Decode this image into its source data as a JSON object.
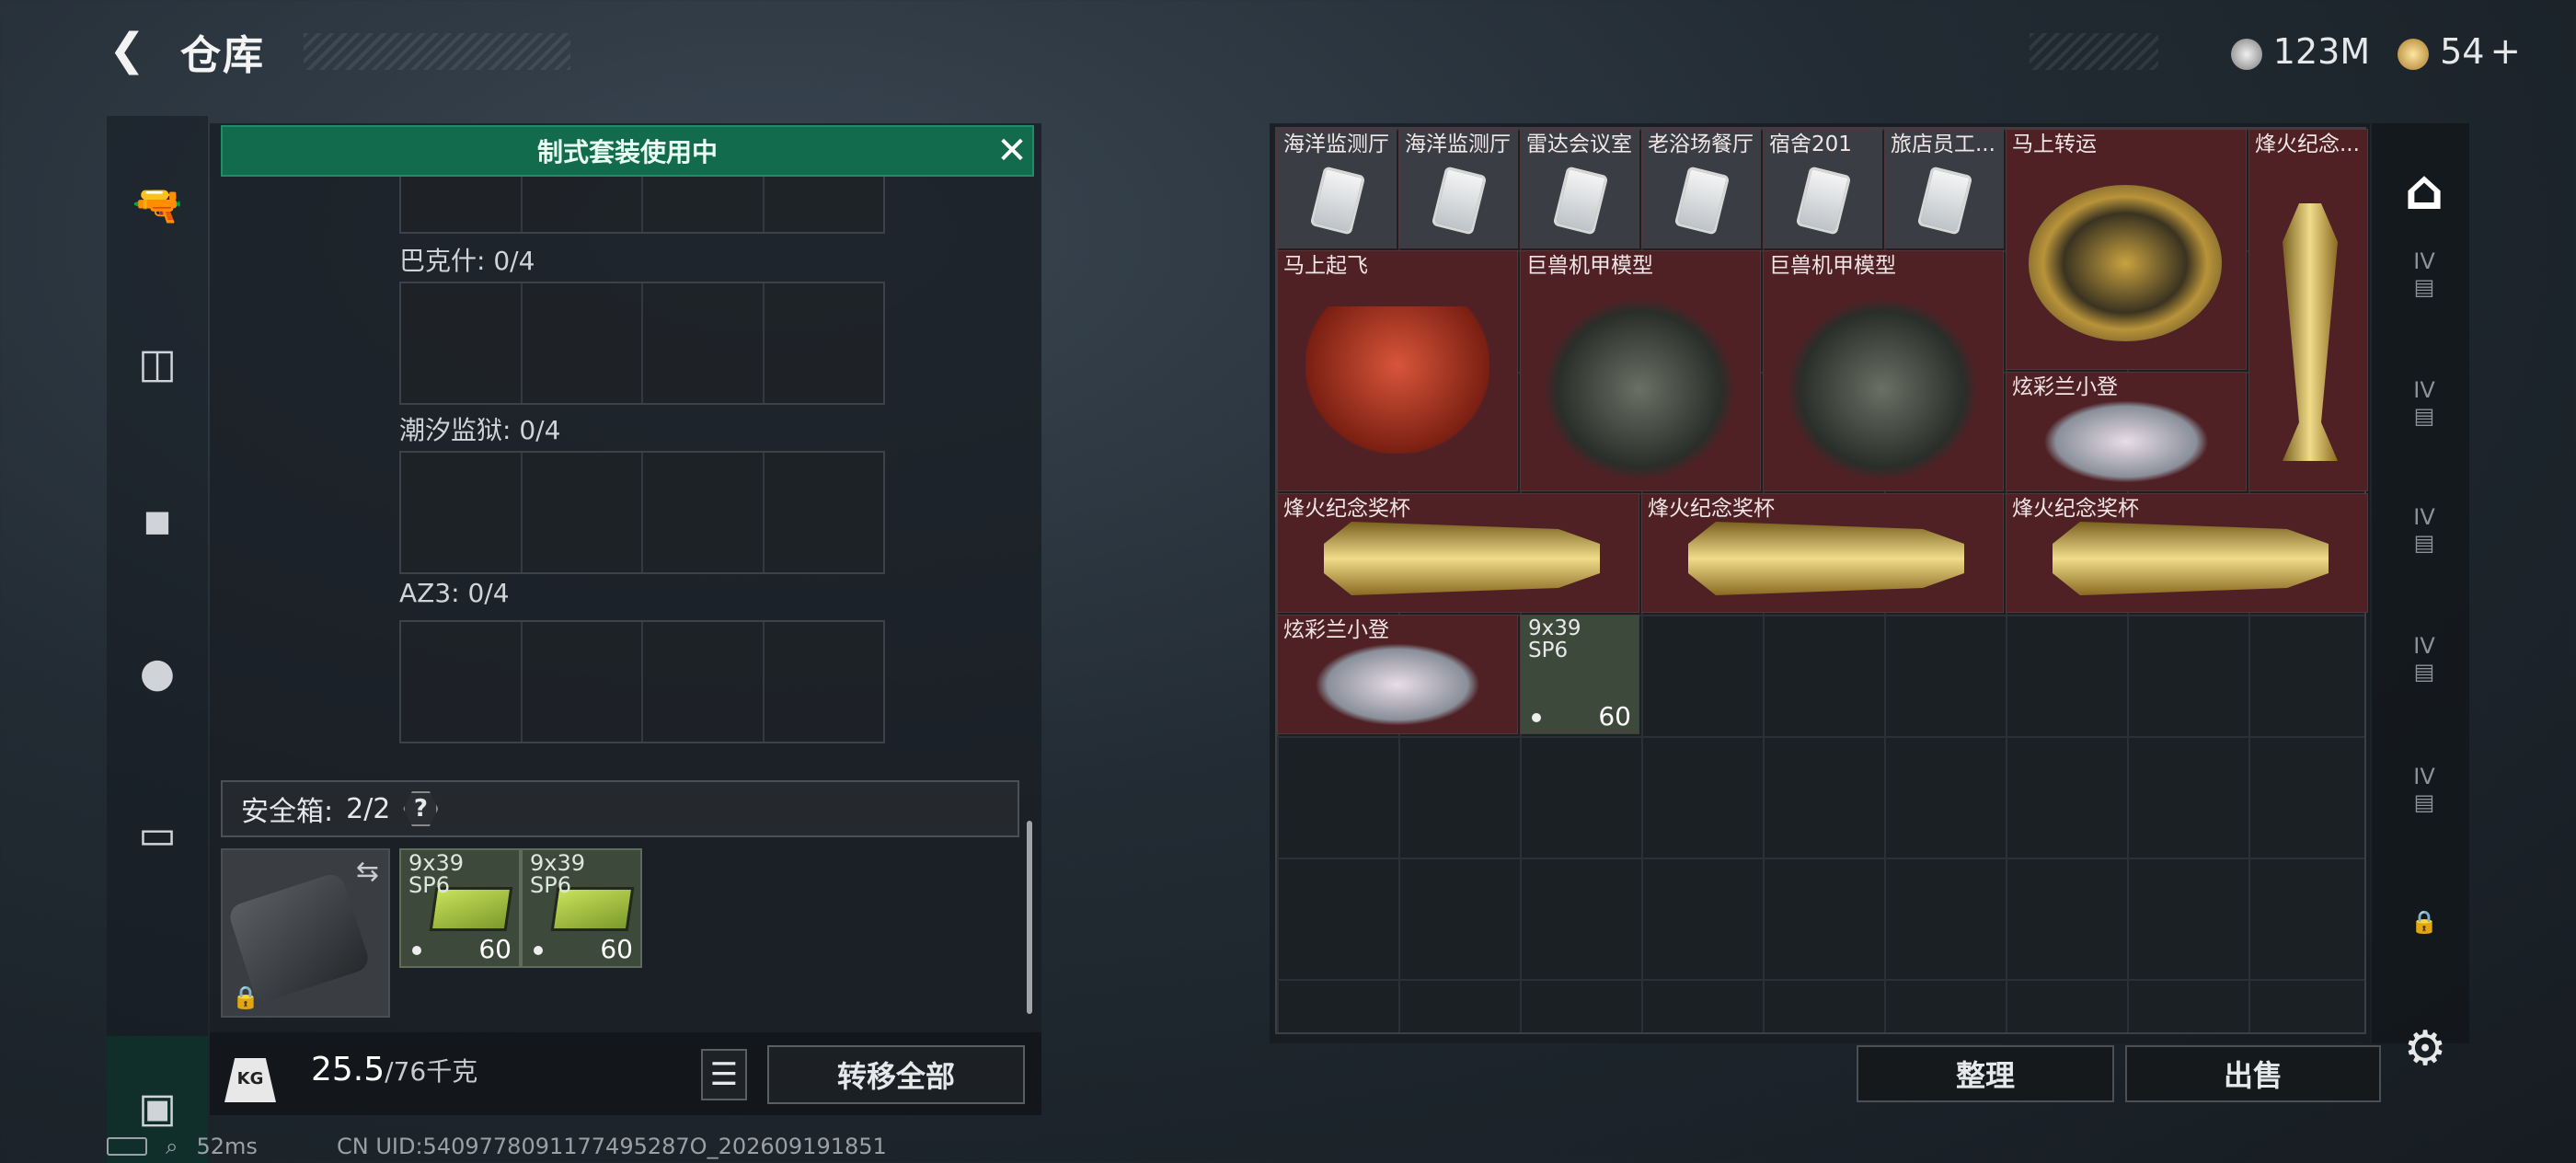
{
  "header": {
    "title": "仓库",
    "currency_silver": "123M",
    "currency_gold": "54",
    "gold_add": "+"
  },
  "banner": {
    "text": "制式套装使用中"
  },
  "equipment": {
    "slots": [
      {
        "label": "巴克什: 0/4"
      },
      {
        "label": "潮汐监狱: 0/4"
      },
      {
        "label": "AZ3: 0/4"
      }
    ],
    "safe_box": {
      "label": "安全箱:",
      "count": "2/2",
      "help": "?"
    },
    "safe_items": [
      {
        "caliber": "9x39\nSP6",
        "qty": "60"
      },
      {
        "caliber": "9x39\nSP6",
        "qty": "60"
      }
    ]
  },
  "bottom": {
    "weight": "25.5",
    "weight_max": "/76千克",
    "kg_badge": "KG",
    "transfer_all": "转移全部"
  },
  "status": {
    "ping": "52ms",
    "uid": "CN UID:5409778091177495287O_202609191851"
  },
  "stash": {
    "items": [
      {
        "name": "海洋监测厅",
        "kind": "card"
      },
      {
        "name": "海洋监测厅",
        "kind": "card"
      },
      {
        "name": "雷达会议室",
        "kind": "card"
      },
      {
        "name": "老浴场餐厅",
        "kind": "card"
      },
      {
        "name": "宿舍201",
        "kind": "card"
      },
      {
        "name": "旅店员工...",
        "kind": "card"
      },
      {
        "name": "马上转运",
        "kind": "disc"
      },
      {
        "name": "烽火纪念...",
        "kind": "trophy-v"
      },
      {
        "name": "马上起飞",
        "kind": "horse"
      },
      {
        "name": "巨兽机甲模型",
        "kind": "mech"
      },
      {
        "name": "巨兽机甲模型",
        "kind": "mech"
      },
      {
        "name": "炫彩兰小登",
        "kind": "toy"
      },
      {
        "name": "烽火纪念奖杯",
        "kind": "trophy-h"
      },
      {
        "name": "烽火纪念奖杯",
        "kind": "trophy-h"
      },
      {
        "name": "烽火纪念奖杯",
        "kind": "trophy-h"
      },
      {
        "name": "炫彩兰小登",
        "kind": "toy"
      },
      {
        "name": "9x39\nSP6",
        "kind": "ammo",
        "qty": "60"
      }
    ]
  },
  "actions": {
    "sort": "整理",
    "sell": "出售"
  },
  "sidebar_right": {
    "tier_labels": [
      "IV",
      "IV",
      "IV",
      "IV",
      "IV"
    ]
  }
}
